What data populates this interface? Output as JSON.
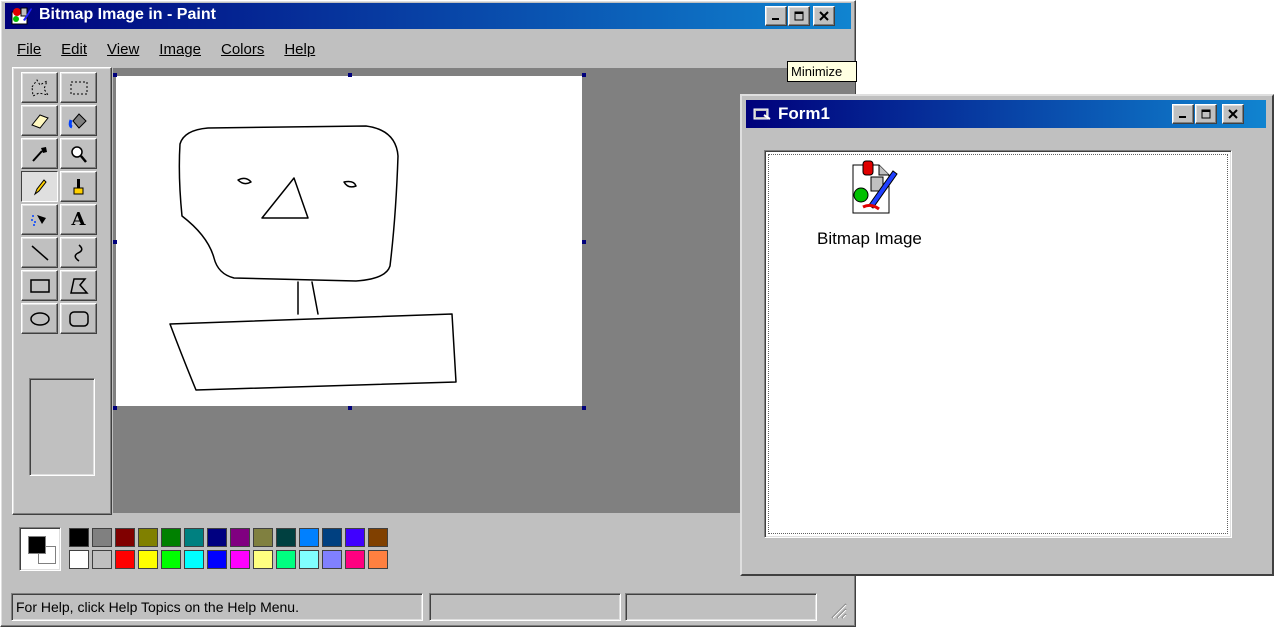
{
  "paint": {
    "title": "Bitmap Image in  - Paint",
    "menu": [
      {
        "label": "File",
        "accel_index": 0
      },
      {
        "label": "Edit",
        "accel_index": 0
      },
      {
        "label": "View",
        "accel_index": 0
      },
      {
        "label": "Image",
        "accel_index": 0
      },
      {
        "label": "Colors",
        "accel_index": 0
      },
      {
        "label": "Help",
        "accel_index": 0
      }
    ],
    "tools": [
      {
        "name": "free-form-select"
      },
      {
        "name": "rectangle-select"
      },
      {
        "name": "eraser"
      },
      {
        "name": "fill-with-color"
      },
      {
        "name": "pick-color"
      },
      {
        "name": "magnifier"
      },
      {
        "name": "pencil",
        "active": true
      },
      {
        "name": "brush"
      },
      {
        "name": "airbrush"
      },
      {
        "name": "text"
      },
      {
        "name": "line"
      },
      {
        "name": "curve"
      },
      {
        "name": "rectangle"
      },
      {
        "name": "polygon"
      },
      {
        "name": "ellipse"
      },
      {
        "name": "rounded-rectangle"
      }
    ],
    "text_tool_glyph": "A",
    "palette": {
      "foreground": "#000000",
      "background": "#ffffff",
      "top_row": [
        "#000000",
        "#808080",
        "#800000",
        "#808000",
        "#008000",
        "#008080",
        "#000080",
        "#800080",
        "#808040",
        "#004040",
        "#0080ff",
        "#004080",
        "#4000ff",
        "#804000"
      ],
      "bottom_row": [
        "#ffffff",
        "#c0c0c0",
        "#ff0000",
        "#ffff00",
        "#00ff00",
        "#00ffff",
        "#0000ff",
        "#ff00ff",
        "#ffff80",
        "#00ff80",
        "#80ffff",
        "#8080ff",
        "#ff0080",
        "#ff8040"
      ]
    },
    "status": {
      "help_text": "For Help, click Help Topics on the Help Menu.",
      "pane2": "",
      "pane3": ""
    },
    "tooltip": "Minimize"
  },
  "form1": {
    "title": "Form1",
    "ole_object_label": "Bitmap Image"
  },
  "colors": {
    "title_active_start": "#00007b",
    "title_active_end": "#1084d0",
    "face": "#c0c0c0",
    "canvas_workspace": "#808080"
  }
}
